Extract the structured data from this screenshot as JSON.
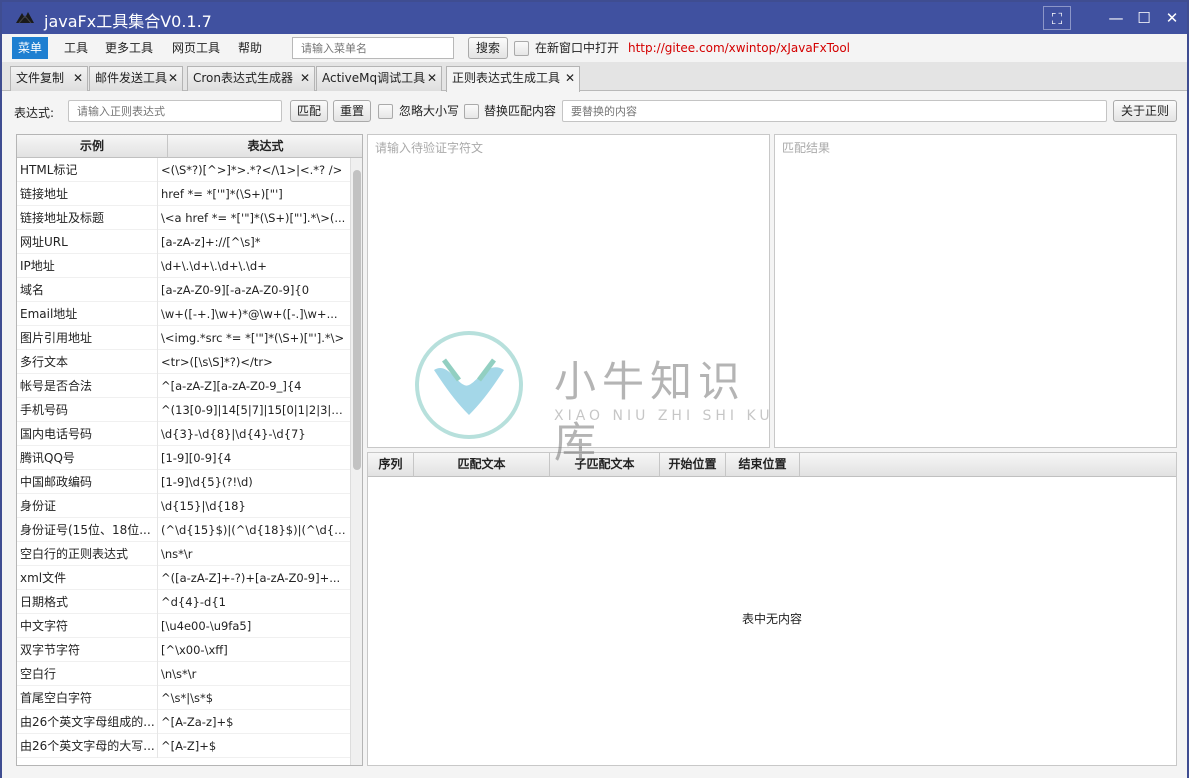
{
  "window": {
    "title": "javaFx工具集合V0.1.7",
    "controls": {
      "fullscreen": "⛶",
      "minimize": "—",
      "maximize": "☐",
      "close": "✕"
    }
  },
  "menubar": {
    "items": [
      "菜单",
      "工具",
      "更多工具",
      "网页工具",
      "帮助"
    ],
    "search_placeholder": "请输入菜单名",
    "search_button": "搜索",
    "new_window_label": "在新窗口中打开",
    "link": "http://gitee.com/xwintop/xJavaFxTool"
  },
  "tabs": [
    {
      "label": "文件复制"
    },
    {
      "label": "邮件发送工具"
    },
    {
      "label": "Cron表达式生成器"
    },
    {
      "label": "ActiveMq调试工具"
    },
    {
      "label": "正则表达式生成工具"
    }
  ],
  "toolbar": {
    "expression_label": "表达式:",
    "expression_placeholder": "请输入正则表达式",
    "match_button": "匹配",
    "reset_button": "重置",
    "ignore_case_label": "忽略大小写",
    "replace_label": "替换匹配内容",
    "replace_placeholder": "要替换的内容",
    "about_button": "关于正则"
  },
  "examples_table": {
    "headers": [
      "示例",
      "表达式"
    ],
    "rows": [
      [
        "HTML标记",
        "<(\\S*?)[^>]*>.*?</\\1>|<.*? />"
      ],
      [
        "链接地址",
        "href *= *['\"]*(\\S+)[\"']"
      ],
      [
        "链接地址及标题",
        "\\<a href *= *['\"]*(\\S+)[\"'].*\\>(..."
      ],
      [
        "网址URL",
        "[a-zA-z]+://[^\\s]*"
      ],
      [
        "IP地址",
        "\\d+\\.\\d+\\.\\d+\\.\\d+"
      ],
      [
        "域名",
        "[a-zA-Z0-9][-a-zA-Z0-9]{0"
      ],
      [
        "Email地址",
        "\\w+([-+.]\\w+)*@\\w+([-.]\\w+..."
      ],
      [
        "图片引用地址",
        "\\<img.*src *= *['\"]*(\\S+)[\"'].*\\>"
      ],
      [
        "多行文本",
        "<tr>([\\s\\S]*?)</tr>"
      ],
      [
        "帐号是否合法",
        "^[a-zA-Z][a-zA-Z0-9_]{4"
      ],
      [
        "手机号码",
        "^(13[0-9]|14[5|7]|15[0|1|2|3|5..."
      ],
      [
        "国内电话号码",
        "\\d{3}-\\d{8}|\\d{4}-\\d{7}"
      ],
      [
        "腾讯QQ号",
        "[1-9][0-9]{4"
      ],
      [
        "中国邮政编码",
        "[1-9]\\d{5}(?!\\d)"
      ],
      [
        "身份证",
        "\\d{15}|\\d{18}"
      ],
      [
        "身份证号(15位、18位...",
        "(^\\d{15}$)|(^\\d{18}$)|(^\\d{17}(d..."
      ],
      [
        "空白行的正则表达式",
        "\\ns*\\r"
      ],
      [
        "xml文件",
        "^([a-zA-Z]+-?)+[a-zA-Z0-9]+..."
      ],
      [
        "日期格式",
        "^d{4}-d{1"
      ],
      [
        "中文字符",
        "[\\u4e00-\\u9fa5]"
      ],
      [
        "双字节字符",
        "[^\\x00-\\xff]"
      ],
      [
        "空白行",
        "\\n\\s*\\r"
      ],
      [
        "首尾空白字符",
        "^\\s*|\\s*$"
      ],
      [
        "由26个英文字母组成的...",
        "^[A-Za-z]+$"
      ],
      [
        "由26个英文字母的大写...",
        "^[A-Z]+$"
      ]
    ]
  },
  "input_panel": {
    "placeholder": "请输入待验证字符文"
  },
  "result_panel": {
    "placeholder": "匹配结果"
  },
  "results_table": {
    "headers": [
      "序列",
      "匹配文本",
      "子匹配文本",
      "开始位置",
      "结束位置"
    ],
    "empty_message": "表中无内容"
  },
  "watermark": {
    "text": "小牛知识库",
    "subtext": "XIAO NIU ZHI SHI KU"
  }
}
